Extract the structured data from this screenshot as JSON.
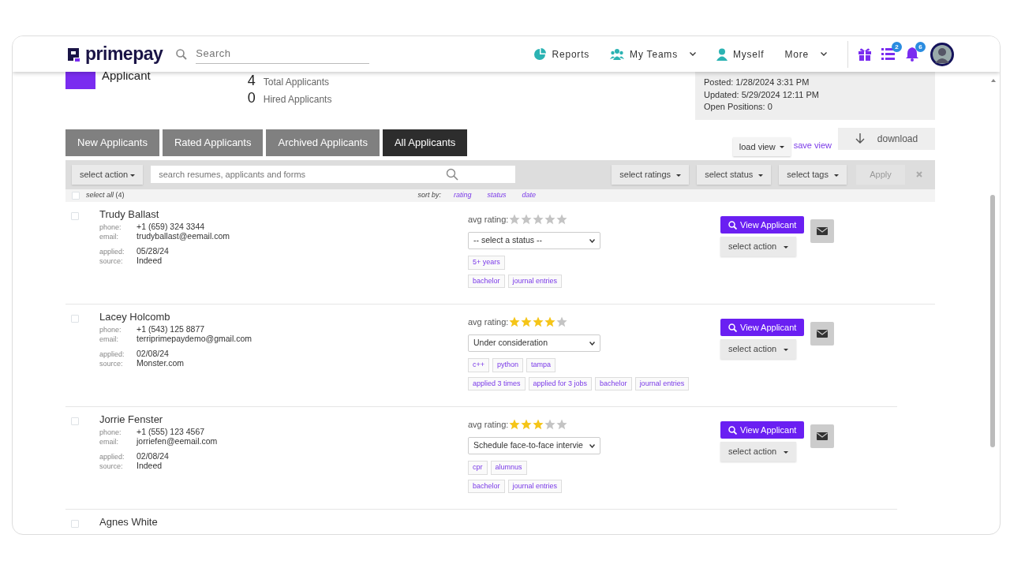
{
  "header": {
    "logo": "primepay",
    "search": {
      "placeholder": "Search"
    },
    "nav": [
      {
        "label": "Reports",
        "kind": "pie",
        "dropdown": false
      },
      {
        "label": "My Teams",
        "kind": "people",
        "dropdown": true
      },
      {
        "label": "Myself",
        "kind": "person",
        "dropdown": false
      },
      {
        "label": "More",
        "kind": "plain",
        "dropdown": true
      }
    ],
    "tools": [
      {
        "kind": "gift"
      },
      {
        "kind": "list",
        "badge": "2"
      },
      {
        "kind": "bell",
        "badge": "6"
      }
    ]
  },
  "job": {
    "title": "Applicant",
    "stats": [
      {
        "count": "4",
        "label": "Total Applicants"
      },
      {
        "count": "0",
        "label": "Hired Applicants"
      }
    ],
    "info": [
      "Posted: 1/28/2024 3:31 PM",
      "Updated: 5/29/2024 12:11 PM",
      "Open Positions: 0"
    ]
  },
  "tabs": [
    {
      "label": "New Applicants",
      "selected": false
    },
    {
      "label": "Rated Applicants",
      "selected": false
    },
    {
      "label": "Archived Applicants",
      "selected": false
    },
    {
      "label": "All Applicants",
      "selected": true
    }
  ],
  "views": {
    "load": "load view",
    "save": "save view",
    "download": "download"
  },
  "toolbar": {
    "action": "select action",
    "search_placeholder": "search resumes, applicants and forms",
    "filters": [
      "select ratings",
      "select status",
      "select tags"
    ],
    "apply": "Apply"
  },
  "select_all": {
    "label": "*select all* (4)",
    "checked": false
  },
  "sort": {
    "label": "sort by:",
    "options": [
      "rating",
      "status",
      "date"
    ]
  },
  "applicants": [
    {
      "name": "Trudy Ballast",
      "checked": false,
      "fields": [
        {
          "label": "phone:",
          "value": "+1 (659) 324 3344"
        },
        {
          "label": "email:",
          "value": "trudyballast@eemail.com"
        },
        {
          "label": "applied:",
          "value": "05/28/24"
        },
        {
          "label": "source:",
          "value": "Indeed"
        }
      ],
      "rating_label": "avg rating:",
      "stars": 0,
      "status": "-- select a status --",
      "tag_lines": [
        [
          "5+ years"
        ],
        [
          "bachelor",
          "journal entries"
        ]
      ],
      "view": "View Applicant",
      "action": "select action"
    },
    {
      "name": "Lacey Holcomb",
      "checked": false,
      "fields": [
        {
          "label": "phone:",
          "value": "+1 (543) 125 8877"
        },
        {
          "label": "email:",
          "value": "terriprimepaydemo@gmail.com"
        },
        {
          "label": "applied:",
          "value": "02/08/24"
        },
        {
          "label": "source:",
          "value": "Monster.com"
        }
      ],
      "rating_label": "avg rating:",
      "stars": 4,
      "status": "Under consideration",
      "tag_lines": [
        [
          "c++",
          "python",
          "tampa"
        ],
        [
          "applied 3 times",
          "applied for 3 jobs",
          "bachelor",
          "journal entries"
        ]
      ],
      "view": "View Applicant",
      "action": "select action"
    },
    {
      "name": "Jorrie Fenster",
      "checked": false,
      "fields": [
        {
          "label": "phone:",
          "value": "+1 (555) 123 4567"
        },
        {
          "label": "email:",
          "value": "jorriefen@eemail.com"
        },
        {
          "label": "applied:",
          "value": "02/08/24"
        },
        {
          "label": "source:",
          "value": "Indeed"
        }
      ],
      "rating_label": "avg rating:",
      "stars": 3,
      "status": "Schedule face-to-face intervie",
      "tag_lines": [
        [
          "cpr",
          "alumnus"
        ],
        [
          "bachelor",
          "journal entries"
        ]
      ],
      "view": "View Applicant",
      "action": "select action"
    },
    {
      "name": "Agnes White",
      "checked": false
    }
  ]
}
